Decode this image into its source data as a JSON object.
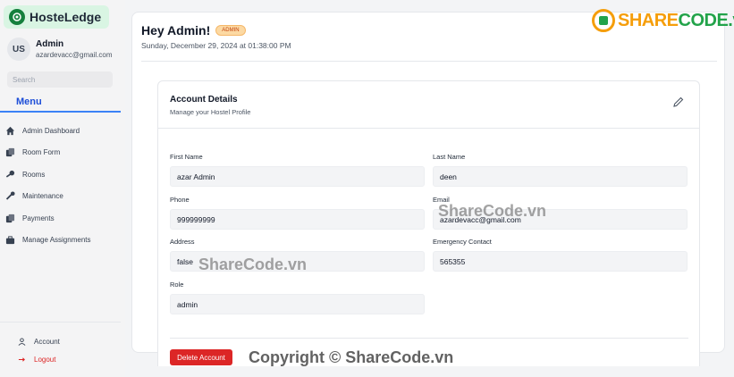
{
  "app": {
    "name": "HosteLedge"
  },
  "user": {
    "initials": "US",
    "name": "Admin",
    "email": "azardevacc@gmail.com"
  },
  "search": {
    "placeholder": "Search"
  },
  "menu": {
    "title": "Menu",
    "items": [
      {
        "label": "Admin Dashboard",
        "icon": "home-icon"
      },
      {
        "label": "Room Form",
        "icon": "documents-icon"
      },
      {
        "label": "Rooms",
        "icon": "key-icon"
      },
      {
        "label": "Maintenance",
        "icon": "wrench-icon"
      },
      {
        "label": "Payments",
        "icon": "documents-icon"
      },
      {
        "label": "Manage Assignments",
        "icon": "briefcase-icon"
      }
    ]
  },
  "bottom": {
    "account": "Account",
    "logout": "Logout"
  },
  "header": {
    "greeting": "Hey Admin!",
    "badge": "ADMIN",
    "datetime": "Sunday, December 29, 2024 at 01:38:00 PM"
  },
  "card": {
    "title": "Account Details",
    "subtitle": "Manage your Hostel Profile",
    "fields": {
      "first_name": {
        "label": "First Name",
        "value": "azar Admin"
      },
      "last_name": {
        "label": "Last Name",
        "value": "deen"
      },
      "phone": {
        "label": "Phone",
        "value": "999999999"
      },
      "email": {
        "label": "Email",
        "value": "azardevacc@gmail.com"
      },
      "address": {
        "label": "Address",
        "value": "false"
      },
      "emergency": {
        "label": "Emergency Contact",
        "value": "565355"
      },
      "role": {
        "label": "Role",
        "value": "admin"
      }
    },
    "delete_label": "Delete Account"
  },
  "watermark": {
    "brand_a": "SHARE",
    "brand_b": "CODE.vn",
    "mid": "ShareCode.vn",
    "copyright": "Copyright © ShareCode.vn"
  },
  "colors": {
    "accent": "#1d4ed8",
    "danger": "#dc2626",
    "badge_bg": "#fcd9a3",
    "logo_bg": "#d9f5e3"
  }
}
